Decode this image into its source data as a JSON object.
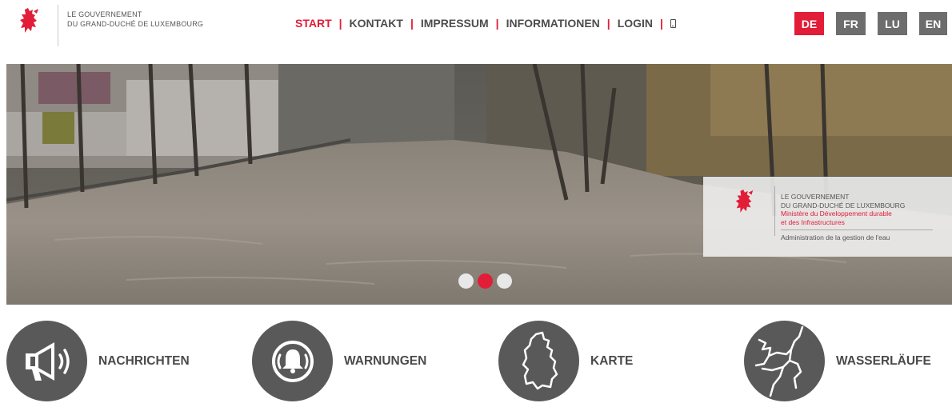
{
  "header": {
    "logo_text_line1": "LE GOUVERNEMENT",
    "logo_text_line2": "DU GRAND-DUCHÉ DE LUXEMBOURG",
    "nav": [
      {
        "label": "START",
        "active": true
      },
      {
        "label": "KONTAKT",
        "active": false
      },
      {
        "label": "IMPRESSUM",
        "active": false
      },
      {
        "label": "INFORMATIONEN",
        "active": false
      },
      {
        "label": "LOGIN",
        "active": false
      }
    ],
    "languages": [
      {
        "label": "DE",
        "active": true
      },
      {
        "label": "FR",
        "active": false
      },
      {
        "label": "LU",
        "active": false
      },
      {
        "label": "EN",
        "active": false
      }
    ]
  },
  "hero": {
    "ministry_line1": "LE GOUVERNEMENT",
    "ministry_line2": "DU GRAND-DUCHÉ DE LUXEMBOURG",
    "ministry_line3": "Ministère du Développement durable",
    "ministry_line4": "et des Infrastructures",
    "ministry_admin": "Administration de la gestion de l'eau",
    "slides_total": 3,
    "active_slide": 2
  },
  "tiles": [
    {
      "label": "NACHRICHTEN",
      "icon": "megaphone-icon"
    },
    {
      "label": "WARNUNGEN",
      "icon": "alarm-bell-icon"
    },
    {
      "label": "KARTE",
      "icon": "luxembourg-map-icon"
    },
    {
      "label": "WASSERLÄUFE",
      "icon": "watercourses-icon"
    }
  ],
  "colors": {
    "accent": "#e11d38",
    "lang_inactive": "#6d6d6d",
    "tile_circle": "#595959",
    "text": "#4a4a4a"
  }
}
